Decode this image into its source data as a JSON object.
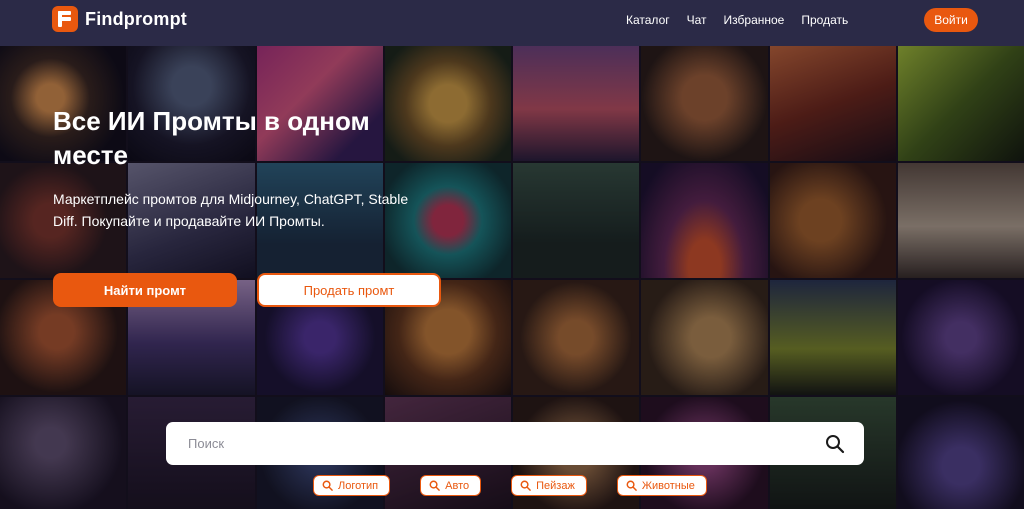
{
  "header": {
    "logo_text": "Findprompt",
    "nav": [
      {
        "label": "Каталог"
      },
      {
        "label": "Чат"
      },
      {
        "label": "Избранное"
      },
      {
        "label": "Продать"
      }
    ],
    "login_label": "Войти"
  },
  "hero": {
    "title": "Все ИИ Промты в одном месте",
    "subtitle": "Маркетплейс промтов для Midjourney, ChatGPT, Stable Diff. Покупайте и продавайте ИИ Промты.",
    "primary_button": "Найти промт",
    "secondary_button": "Продать промт"
  },
  "search": {
    "placeholder": "Поиск",
    "value": ""
  },
  "chips": [
    {
      "label": "Логотип",
      "icon": "search-icon"
    },
    {
      "label": "Авто",
      "icon": "search-icon"
    },
    {
      "label": "Пейзаж",
      "icon": "search-icon"
    },
    {
      "label": "Животные",
      "icon": "search-icon"
    }
  ],
  "colors": {
    "accent": "#e9580f",
    "header_bg": "#2b2a47",
    "white": "#ffffff"
  }
}
